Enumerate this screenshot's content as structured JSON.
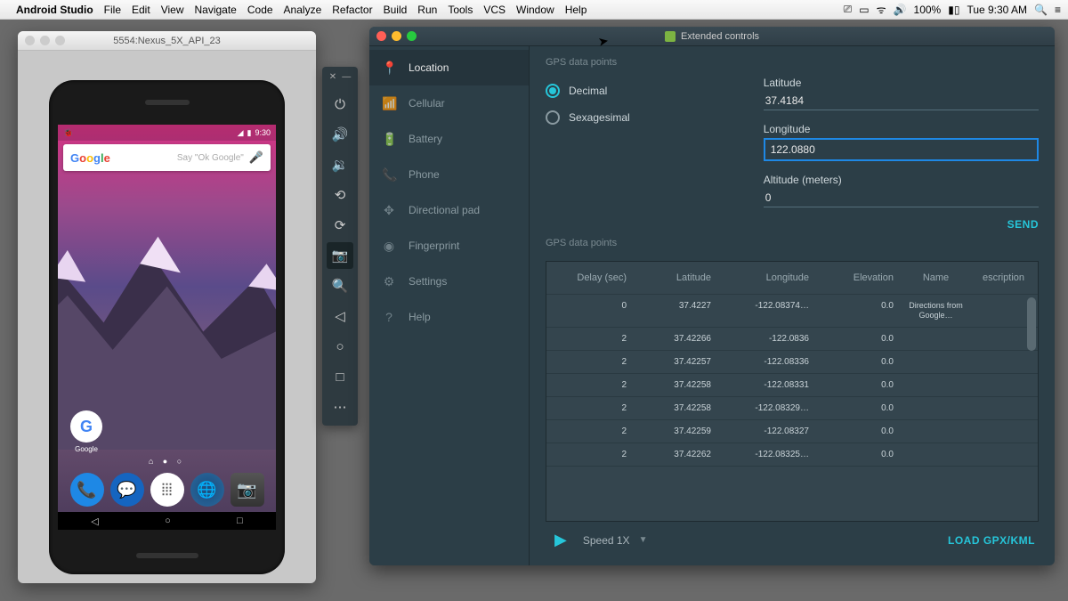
{
  "menubar": {
    "app": "Android Studio",
    "items": [
      "File",
      "Edit",
      "View",
      "Navigate",
      "Code",
      "Analyze",
      "Refactor",
      "Build",
      "Run",
      "Tools",
      "VCS",
      "Window",
      "Help"
    ],
    "battery": "100%",
    "clock": "Tue 9:30 AM"
  },
  "emulator": {
    "title": "5554:Nexus_5X_API_23",
    "status_time": "9:30",
    "search_placeholder": "Say \"Ok Google\"",
    "google_app_label": "Google"
  },
  "toolbar_icons": [
    "power",
    "vol-up",
    "vol-down",
    "rotate-left",
    "rotate-right",
    "camera",
    "zoom",
    "back",
    "home",
    "overview",
    "more"
  ],
  "ext": {
    "title": "Extended controls",
    "sidebar": [
      {
        "icon": "📍",
        "label": "Location"
      },
      {
        "icon": "📶",
        "label": "Cellular"
      },
      {
        "icon": "🔋",
        "label": "Battery"
      },
      {
        "icon": "📞",
        "label": "Phone"
      },
      {
        "icon": "✥",
        "label": "Directional pad"
      },
      {
        "icon": "◉",
        "label": "Fingerprint"
      },
      {
        "icon": "⚙",
        "label": "Settings"
      },
      {
        "icon": "?",
        "label": "Help"
      }
    ],
    "gps_label": "GPS data points",
    "format": {
      "decimal": "Decimal",
      "sexagesimal": "Sexagesimal"
    },
    "fields": {
      "latitude_label": "Latitude",
      "latitude": "37.4184",
      "longitude_label": "Longitude",
      "longitude": "122.0880",
      "altitude_label": "Altitude (meters)",
      "altitude": "0"
    },
    "send": "SEND",
    "table": {
      "headers": {
        "delay": "Delay (sec)",
        "lat": "Latitude",
        "lon": "Longitude",
        "elev": "Elevation",
        "name": "Name",
        "desc": "escription"
      },
      "rows": [
        {
          "delay": "0",
          "lat": "37.4227",
          "lon": "-122.08374…",
          "elev": "0.0",
          "name": "Directions from Google…",
          "desc": ""
        },
        {
          "delay": "2",
          "lat": "37.42266",
          "lon": "-122.0836",
          "elev": "0.0",
          "name": "",
          "desc": ""
        },
        {
          "delay": "2",
          "lat": "37.42257",
          "lon": "-122.08336",
          "elev": "0.0",
          "name": "",
          "desc": ""
        },
        {
          "delay": "2",
          "lat": "37.42258",
          "lon": "-122.08331",
          "elev": "0.0",
          "name": "",
          "desc": ""
        },
        {
          "delay": "2",
          "lat": "37.42258",
          "lon": "-122.08329…",
          "elev": "0.0",
          "name": "",
          "desc": ""
        },
        {
          "delay": "2",
          "lat": "37.42259",
          "lon": "-122.08327",
          "elev": "0.0",
          "name": "",
          "desc": ""
        },
        {
          "delay": "2",
          "lat": "37.42262",
          "lon": "-122.08325…",
          "elev": "0.0",
          "name": "",
          "desc": ""
        }
      ]
    },
    "speed": "Speed 1X",
    "load": "LOAD GPX/KML"
  }
}
